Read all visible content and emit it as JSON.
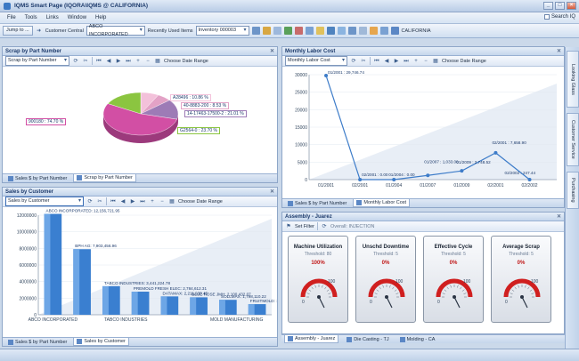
{
  "window": {
    "title": "IQMS Smart Page (IQORA\\IQMS @ CALIFORNIA)",
    "search_label": "Search IQ"
  },
  "menu": [
    "File",
    "Tools",
    "Links",
    "Window",
    "Help"
  ],
  "toolbar": {
    "jump_to": "Jump to ...",
    "customer_central": "Customer Central",
    "customer_value": "ABCO INCORPORATED",
    "recent_items": "Recently Used Items",
    "recent_value": "Inventory 000003",
    "location": "CALIFORNIA"
  },
  "common": {
    "choose_date_range": "Choose Date Range",
    "set_filter": "Set Filter",
    "overall_injection": "Overall: INJECTION"
  },
  "scrap_panel": {
    "title": "Scrap by Part Number",
    "combo": "Scrap by Part Number",
    "labels": [
      "A28496",
      "40-8883-200",
      "14-17463-17500-2",
      "900180",
      "G2564-0"
    ],
    "pcts": [
      "10.86 %",
      "8.53 %",
      "21.01 %",
      "74.70 %",
      "23.70 %"
    ],
    "tabs": [
      "Sales $ by Part Number",
      "Scrap by Part Number"
    ]
  },
  "labor_panel": {
    "title": "Monthly Labor Cost",
    "combo": "Monthly Labor Cost",
    "tabs": [
      "Sales $ by Part Number",
      "Monthly Labor Cost"
    ]
  },
  "sales_panel": {
    "title": "Sales by Customer",
    "combo": "Sales by Customer",
    "tabs": [
      "Sales $ by Part Number",
      "Sales by Customer"
    ],
    "bar_labels": [
      "ABCO INCORPORATED: 12,156,721.95",
      "BPH AG: 7,903,456.96",
      "TABCO INDUSTRIES: 3,441,224.78",
      "PREMOLD FRESH ELEC: 2,784,612.31",
      "DATAMAX: 2,211,930.45",
      "BLUE ROSE JMH: 2,100,432.07",
      "SOLLMAX: 1,798,110.22",
      "FRUITMOLD: 1,279,349.53"
    ],
    "x_labels": [
      "ABCO INCORPORATED",
      "TABCO INDUSTRIES",
      "MOLD MANUFACTURING"
    ]
  },
  "assembly_panel": {
    "title": "Assembly - Juarez",
    "gauges": [
      {
        "title": "Machine Utilization",
        "threshold": "Threshold: 80",
        "value": "100%",
        "min": "0",
        "max": "100"
      },
      {
        "title": "Unschd Downtime",
        "threshold": "Threshold: 5",
        "value": "0%",
        "min": "0",
        "max": "100"
      },
      {
        "title": "Effective Cycle",
        "threshold": "Threshold: 5",
        "value": "0%",
        "min": "0",
        "max": "100"
      },
      {
        "title": "Average Scrap",
        "threshold": "Threshold: 5",
        "value": "0%",
        "min": "0",
        "max": "100"
      }
    ],
    "tabs": [
      "Assembly - Juarez",
      "Die Casting - TJ",
      "Molding - CA"
    ]
  },
  "side_tabs": [
    "Looking Glass",
    "Customer Service",
    "Purchasing"
  ],
  "chart_data": [
    {
      "type": "pie",
      "title": "Scrap by Part Number",
      "categories": [
        "A28496",
        "40-8883-200",
        "14-17463-17500-2",
        "900180",
        "G2564-0"
      ],
      "values": [
        10.86,
        8.53,
        21.01,
        74.7,
        23.7
      ],
      "colors": [
        "#f3c1da",
        "#e3a2c6",
        "#9d7bb6",
        "#d24fa4",
        "#8bc540"
      ]
    },
    {
      "type": "line",
      "title": "Monthly Labor Cost",
      "x": [
        "01/2001",
        "02/2001",
        "01/2004",
        "01/2007",
        "01/2009",
        "02/2001",
        "02/2002"
      ],
      "y_ticks": [
        0,
        5000,
        10000,
        15000,
        20000,
        25000,
        30000
      ],
      "series": [
        {
          "name": "Labor Cost",
          "values": [
            29746.74,
            0,
            0,
            1200,
            2500,
            7658.9,
            0
          ]
        }
      ],
      "point_labels": [
        "01/2001 : 29,746.74",
        "02/2001 : 0.00",
        "01/2004 : 0.00",
        "01/2007 : 1,033.00",
        "01/2009 : 2,748.52",
        "02/2001 : 7,658.90",
        "02/2002 : 247.44"
      ],
      "ylim": [
        0,
        30000
      ]
    },
    {
      "type": "bar",
      "title": "Sales by Customer",
      "y_ticks": [
        "0",
        "2000000",
        "4000000",
        "6000000",
        "8000000",
        "10000000",
        "12000000"
      ],
      "values": [
        12156721,
        7903456,
        3441224,
        2784612,
        2211930,
        2100432,
        1798110,
        1279349
      ],
      "ylim": [
        0,
        12000000
      ]
    }
  ]
}
